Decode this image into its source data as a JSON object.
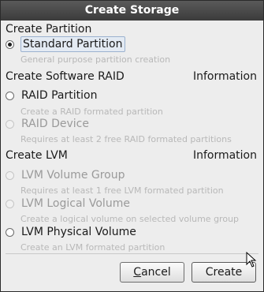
{
  "window": {
    "title": "Create Storage"
  },
  "sections": {
    "partition": {
      "label": "Create Partition",
      "options": [
        {
          "label": "Standard Partition",
          "description": "General purpose partition creation",
          "checked": true,
          "enabled": true
        }
      ]
    },
    "raid": {
      "label": "Create Software RAID",
      "info": "Information",
      "options": [
        {
          "label": "RAID Partition",
          "description": "Create a RAID formated partition",
          "checked": false,
          "enabled": true
        },
        {
          "label": "RAID Device",
          "description": "Requires at least 2 free RAID formated partitions",
          "checked": false,
          "enabled": false
        }
      ]
    },
    "lvm": {
      "label": "Create LVM",
      "info": "Information",
      "options": [
        {
          "label": "LVM Volume Group",
          "description": "Requires at least 1 free LVM formated partition",
          "checked": false,
          "enabled": false
        },
        {
          "label": "LVM Logical Volume",
          "description": "Create a logical volume on selected volume group",
          "checked": false,
          "enabled": false
        },
        {
          "label": "LVM Physical Volume",
          "description": "Create an LVM formated partition",
          "checked": false,
          "enabled": true
        }
      ]
    }
  },
  "buttons": {
    "cancel": {
      "mnemonic": "C",
      "rest": "ancel"
    },
    "create": {
      "label": "Create"
    }
  },
  "icons": {
    "cursor": "mouse-pointer-icon"
  }
}
